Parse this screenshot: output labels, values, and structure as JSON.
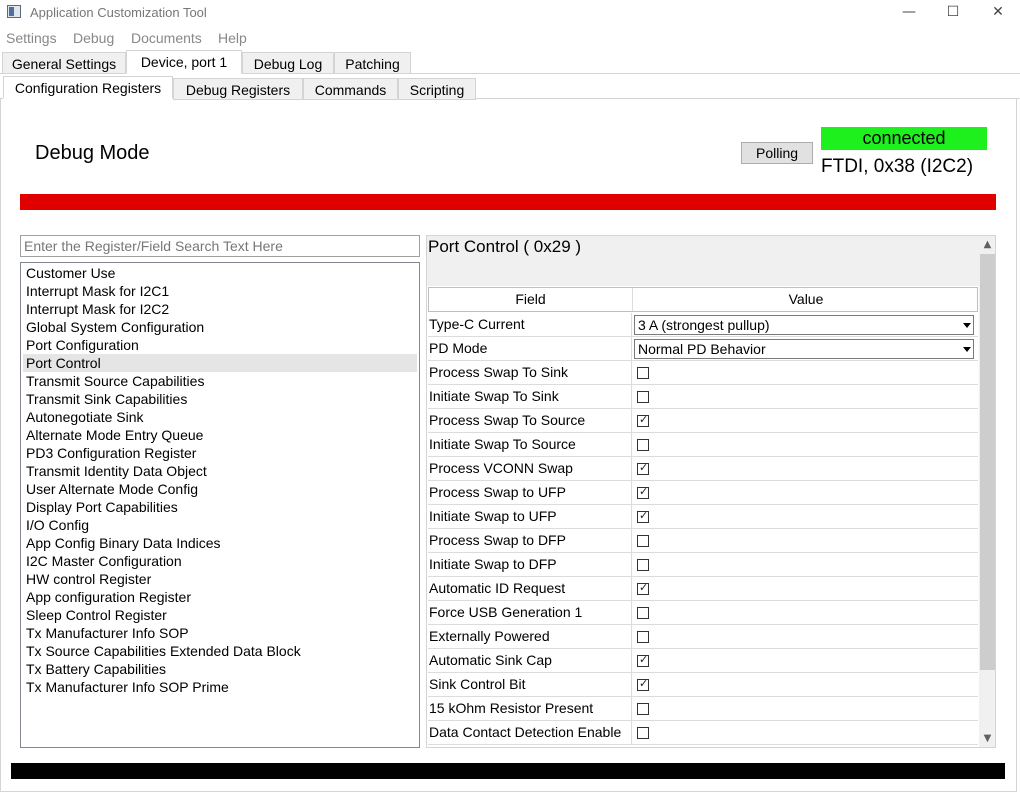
{
  "window": {
    "title": "Application Customization Tool",
    "minimize_glyph": "—",
    "maximize_glyph": "☐",
    "close_glyph": "✕"
  },
  "menu": [
    "Settings",
    "Debug",
    "Documents",
    "Help"
  ],
  "main_tabs": [
    {
      "label": "General Settings",
      "active": false
    },
    {
      "label": "Device, port 1",
      "active": true
    },
    {
      "label": "Debug Log",
      "active": false
    },
    {
      "label": "Patching",
      "active": false
    }
  ],
  "sub_tabs": [
    {
      "label": "Configuration Registers",
      "active": true
    },
    {
      "label": "Debug Registers",
      "active": false
    },
    {
      "label": "Commands",
      "active": false
    },
    {
      "label": "Scripting",
      "active": false
    }
  ],
  "mode_label": "Debug Mode",
  "polling_button": "Polling",
  "status": {
    "text": "connected",
    "color": "#1ef01e",
    "connection": "FTDI, 0x38 (I2C2)"
  },
  "banner_color": "#e00000",
  "search": {
    "placeholder": "Enter the Register/Field Search Text Here",
    "value": ""
  },
  "register_list": {
    "selected": "Port Control",
    "items": [
      "Customer Use",
      "Interrupt Mask for I2C1",
      "Interrupt Mask for I2C2",
      "Global System Configuration",
      "Port Configuration",
      "Port Control",
      "Transmit Source Capabilities",
      "Transmit Sink Capabilities",
      "Autonegotiate Sink",
      "Alternate Mode Entry Queue",
      "PD3 Configuration Register",
      "Transmit Identity Data Object",
      "User Alternate Mode Config",
      "Display Port Capabilities",
      "I/O Config",
      "App Config Binary Data Indices",
      "I2C Master Configuration",
      "HW control Register",
      "App configuration Register",
      "Sleep Control Register",
      "Tx Manufacturer Info SOP",
      "Tx Source Capabilities Extended Data Block",
      "Tx Battery Capabilities",
      "Tx Manufacturer Info SOP Prime"
    ]
  },
  "detail": {
    "title": "Port Control  ( 0x29 )",
    "columns": {
      "field": "Field",
      "value": "Value"
    },
    "rows": [
      {
        "field": "Type-C Current",
        "type": "combo",
        "value": "3 A (strongest pullup)"
      },
      {
        "field": "PD Mode",
        "type": "combo",
        "value": "Normal PD Behavior"
      },
      {
        "field": "Process Swap To Sink",
        "type": "check",
        "checked": false
      },
      {
        "field": "Initiate Swap To Sink",
        "type": "check",
        "checked": false
      },
      {
        "field": "Process Swap To Source",
        "type": "check",
        "checked": true
      },
      {
        "field": "Initiate Swap To Source",
        "type": "check",
        "checked": false
      },
      {
        "field": "Process VCONN Swap",
        "type": "check",
        "checked": true
      },
      {
        "field": "Process Swap to UFP",
        "type": "check",
        "checked": true
      },
      {
        "field": "Initiate Swap to UFP",
        "type": "check",
        "checked": true
      },
      {
        "field": "Process Swap to DFP",
        "type": "check",
        "checked": false
      },
      {
        "field": "Initiate Swap to DFP",
        "type": "check",
        "checked": false
      },
      {
        "field": "Automatic ID Request",
        "type": "check",
        "checked": true
      },
      {
        "field": "Force USB Generation 1",
        "type": "check",
        "checked": false
      },
      {
        "field": "Externally Powered",
        "type": "check",
        "checked": false
      },
      {
        "field": "Automatic Sink Cap",
        "type": "check",
        "checked": true
      },
      {
        "field": "Sink Control Bit",
        "type": "check",
        "checked": true
      },
      {
        "field": "15 kOhm Resistor Present",
        "type": "check",
        "checked": false
      },
      {
        "field": "Data Contact Detection Enable",
        "type": "check",
        "checked": false
      }
    ]
  },
  "icons": {
    "checkmark": "✓",
    "scroll_up": "▲",
    "scroll_down": "▼"
  }
}
